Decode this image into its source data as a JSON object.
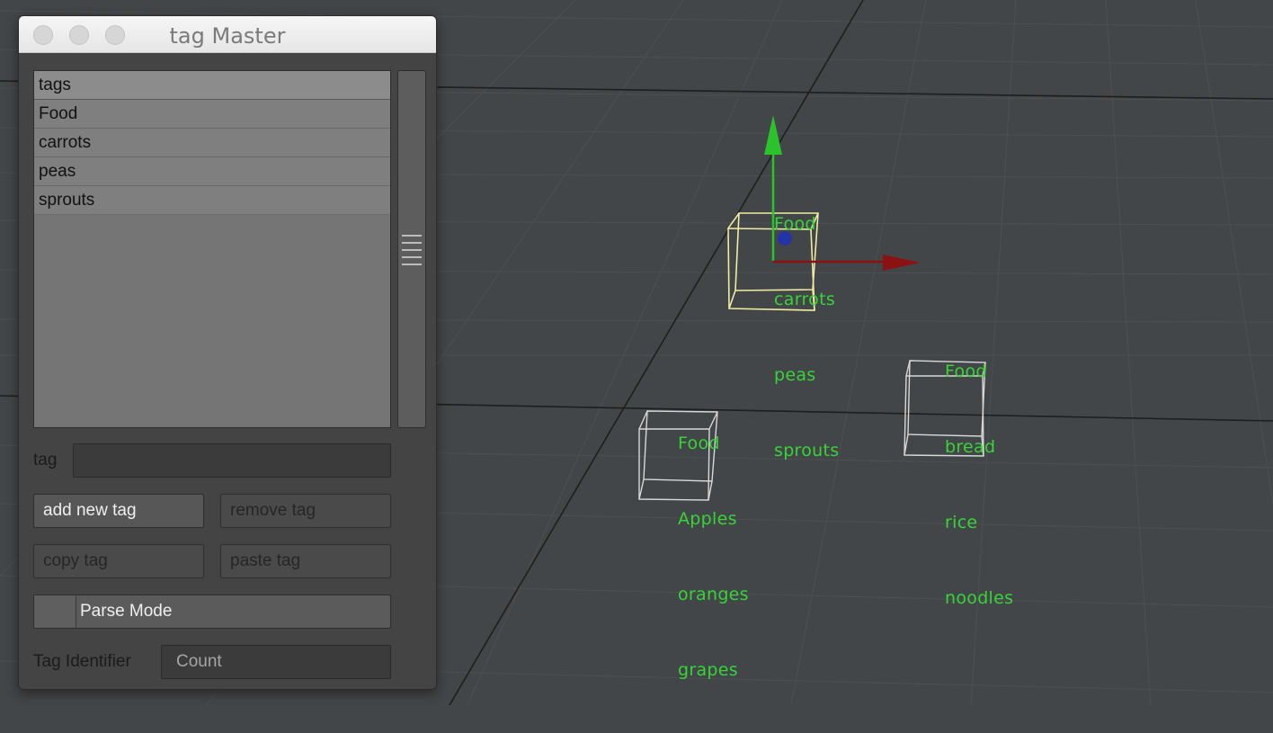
{
  "window": {
    "title": "tag Master",
    "tag_list": {
      "header": "tags",
      "items": [
        "Food",
        "carrots",
        "peas",
        "sprouts"
      ]
    },
    "tag_field": {
      "label": "tag",
      "value": ""
    },
    "buttons": {
      "add_new_tag": "add new tag",
      "remove_tag": "remove tag",
      "copy_tag": "copy tag",
      "paste_tag": "paste tag"
    },
    "parse_mode": {
      "label": "Parse Mode",
      "checked": false
    },
    "tag_identifier": {
      "label": "Tag Identifier",
      "value": "Count"
    }
  },
  "viewport": {
    "objects": [
      {
        "name": "selected-cube",
        "labels": [
          "Food",
          "carrots",
          "peas",
          "sprouts"
        ],
        "color": "#f5f0a8"
      },
      {
        "name": "right-cube",
        "labels": [
          "Food",
          "bread",
          "rice",
          "noodles"
        ],
        "color": "#d8d8d8"
      },
      {
        "name": "left-cube",
        "labels": [
          "Food",
          "Apples",
          "oranges",
          "grapes"
        ],
        "color": "#d8d8d8"
      }
    ],
    "label_color": "#37d437"
  }
}
